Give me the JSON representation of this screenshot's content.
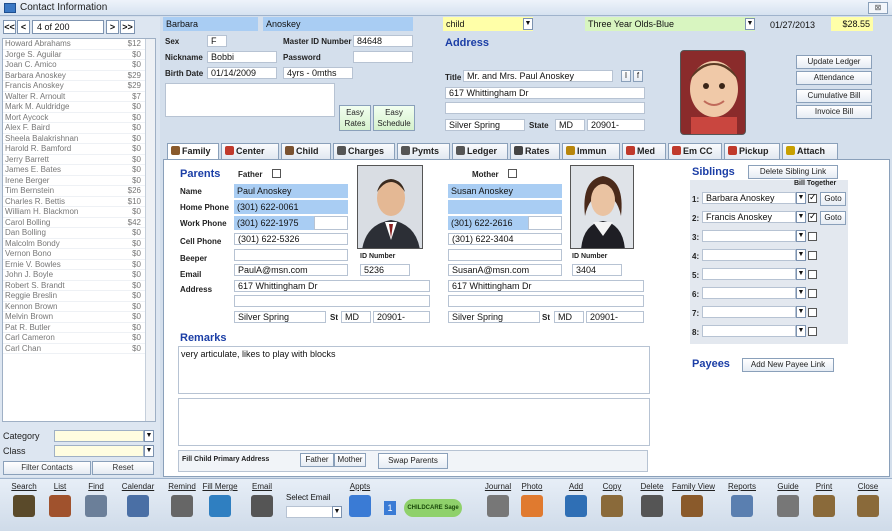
{
  "window": {
    "title": "Contact Information",
    "close": "⊠"
  },
  "nav": {
    "first": "<<",
    "prev": "<",
    "record": "4 of 200",
    "next": ">",
    "last": ">>"
  },
  "list": [
    {
      "name": "Howard Abrahams",
      "amt": "$12"
    },
    {
      "name": "Jorge S. Aguilar",
      "amt": "$0"
    },
    {
      "name": "Joan C. Amico",
      "amt": "$0"
    },
    {
      "name": "Barbara Anoskey",
      "amt": "$29"
    },
    {
      "name": "Francis Anoskey",
      "amt": "$29"
    },
    {
      "name": "Walter R. Arnoult",
      "amt": "$7"
    },
    {
      "name": "Mark M. Auldridge",
      "amt": "$0"
    },
    {
      "name": "Mort Aycock",
      "amt": "$0"
    },
    {
      "name": "Alex F. Baird",
      "amt": "$0"
    },
    {
      "name": "Sheela Balakrishnan",
      "amt": "$0"
    },
    {
      "name": "Harold R. Bamford",
      "amt": "$0"
    },
    {
      "name": "Jerry Barrett",
      "amt": "$0"
    },
    {
      "name": "James E. Bates",
      "amt": "$0"
    },
    {
      "name": "Irene Berger",
      "amt": "$0"
    },
    {
      "name": "Tim Bernstein",
      "amt": "$26"
    },
    {
      "name": "Charles R. Bettis",
      "amt": "$10"
    },
    {
      "name": "William H. Blackmon",
      "amt": "$0"
    },
    {
      "name": "Carol Bolling",
      "amt": "$42"
    },
    {
      "name": "Dan Bolling",
      "amt": "$0"
    },
    {
      "name": "Malcolm Bondy",
      "amt": "$0"
    },
    {
      "name": "Vernon Bono",
      "amt": "$0"
    },
    {
      "name": "Ernie V. Bowles",
      "amt": "$0"
    },
    {
      "name": "John J. Boyle",
      "amt": "$0"
    },
    {
      "name": "Robert S. Brandt",
      "amt": "$0"
    },
    {
      "name": "Reggie Breslin",
      "amt": "$0"
    },
    {
      "name": "Kennon Brown",
      "amt": "$0"
    },
    {
      "name": "Melvin Brown",
      "amt": "$0"
    },
    {
      "name": "Pat R. Butler",
      "amt": "$0"
    },
    {
      "name": "Carl Cameron",
      "amt": "$0"
    },
    {
      "name": "Carl Chan",
      "amt": "$0"
    }
  ],
  "filters": {
    "category_label": "Category",
    "class_label": "Class",
    "filter_btn": "Filter Contacts",
    "reset_btn": "Reset"
  },
  "header": {
    "first_name": "Barbara",
    "last_name": "Anoskey",
    "sex_label": "Sex",
    "sex": "F",
    "master_id_label": "Master ID Number",
    "master_id": "84648",
    "nickname_label": "Nickname",
    "nickname": "Bobbi",
    "password_label": "Password",
    "password": "",
    "birthdate_label": "Birth Date",
    "birthdate": "01/14/2009",
    "age": "4yrs - 0mths",
    "easy_rates": "Easy Rates",
    "easy_schedule": "Easy Schedule",
    "role": "child",
    "class": "Three Year Olds-Blue",
    "date": "01/27/2013",
    "balance": "$28.55",
    "address_title": "Address",
    "title_label": "Title",
    "title_value": "Mr. and Mrs. Paul Anoskey",
    "street": "617 Whittingham Dr",
    "city": "Silver Spring",
    "state_label": "State",
    "state": "MD",
    "zip": "20901-",
    "update_ledger": "Update Ledger",
    "attendance": "Attendance",
    "cumulative_bill": "Cumulative Bill",
    "invoice_bill": "Invoice Bill"
  },
  "tabs": [
    {
      "label": "Family",
      "color": "#8a5a2b"
    },
    {
      "label": "Center",
      "color": "#c0392b"
    },
    {
      "label": "Child",
      "color": "#7a5230"
    },
    {
      "label": "Charges",
      "color": "#555"
    },
    {
      "label": "Pymts",
      "color": "#555"
    },
    {
      "label": "Ledger",
      "color": "#555"
    },
    {
      "label": "Rates",
      "color": "#444"
    },
    {
      "label": "Immun",
      "color": "#b8860b"
    },
    {
      "label": "Med",
      "color": "#c0392b"
    },
    {
      "label": "Em CC",
      "color": "#c0392b"
    },
    {
      "label": "Pickup",
      "color": "#c0392b"
    },
    {
      "label": "Attach",
      "color": "#c8a000"
    }
  ],
  "family": {
    "parents_title": "Parents",
    "father_label": "Father",
    "mother_label": "Mother",
    "name_label": "Name",
    "home_label": "Home Phone",
    "work_label": "Work Phone",
    "cell_label": "Cell Phone",
    "beeper_label": "Beeper",
    "email_label": "Email",
    "address_label": "Address",
    "id_label": "ID Number",
    "father": {
      "name": "Paul Anoskey",
      "home": "(301) 622-0061",
      "work": "(301) 622-1975",
      "cell": "(301) 622-5326",
      "beeper": "",
      "email": "PaulA@msn.com",
      "id": "5236",
      "street": "617 Whittingham Dr",
      "city": "Silver Spring",
      "st_label": "St",
      "st": "MD",
      "zip": "20901-"
    },
    "mother": {
      "name": "Susan Anoskey",
      "home": "",
      "work": "(301) 622-2616",
      "cell": "(301) 622-3404",
      "beeper": "",
      "email": "SusanA@msn.com",
      "id": "3404",
      "street": "617 Whittingham Dr",
      "city": "Silver Spring",
      "st_label": "St",
      "st": "MD",
      "zip": "20901-"
    },
    "remarks_title": "Remarks",
    "remarks": "very articulate, likes to play with blocks",
    "fill_label": "Fill Child Primary Address",
    "father_btn": "Father",
    "mother_btn": "Mother",
    "swap_btn": "Swap Parents"
  },
  "siblings": {
    "title": "Siblings",
    "delete_btn": "Delete Sibling Link",
    "bill_together": "Bill Together",
    "goto": "Goto",
    "rows": [
      {
        "n": "1:",
        "name": "Barbara Anoskey",
        "checked": true
      },
      {
        "n": "2:",
        "name": "Francis Anoskey",
        "checked": true
      },
      {
        "n": "3:",
        "name": "",
        "checked": false
      },
      {
        "n": "4:",
        "name": "",
        "checked": false
      },
      {
        "n": "5:",
        "name": "",
        "checked": false
      },
      {
        "n": "6:",
        "name": "",
        "checked": false
      },
      {
        "n": "7:",
        "name": "",
        "checked": false
      },
      {
        "n": "8:",
        "name": "",
        "checked": false
      }
    ]
  },
  "payees": {
    "title": "Payees",
    "add_btn": "Add New Payee Link"
  },
  "toolbar": [
    {
      "label": "Search",
      "icon": "binoculars-icon",
      "color": "#5a4a2a"
    },
    {
      "label": "List",
      "icon": "books-icon",
      "color": "#a0522d"
    },
    {
      "label": "Find",
      "icon": "magnifier-icon",
      "color": "#6b7f99"
    },
    {
      "label": "Calendar",
      "icon": "calendar-icon",
      "color": "#4a6fa5"
    },
    {
      "label": "Remind",
      "icon": "gear-icon",
      "color": "#666"
    },
    {
      "label": "Fill Merge",
      "icon": "merge-icon",
      "color": "#2f7fc1"
    },
    {
      "label": "Email",
      "icon": "email-icon",
      "color": "#555"
    },
    {
      "label": "Select Email",
      "icon": "",
      "color": ""
    },
    {
      "label": "Appts",
      "icon": "appts-icon",
      "color": "#3a7bd5"
    },
    {
      "label": "Journal",
      "icon": "journal-icon",
      "color": "#777"
    },
    {
      "label": "Photo",
      "icon": "photo-icon",
      "color": "#e07a2f"
    },
    {
      "label": "Add",
      "icon": "add-icon",
      "color": "#2f6fb5"
    },
    {
      "label": "Copy",
      "icon": "copy-icon",
      "color": "#8a6a3a"
    },
    {
      "label": "Delete",
      "icon": "trash-icon",
      "color": "#555"
    },
    {
      "label": "Family View",
      "icon": "family-icon",
      "color": "#8a5a2b"
    },
    {
      "label": "Reports",
      "icon": "reports-icon",
      "color": "#5a7fb0"
    },
    {
      "label": "Guide",
      "icon": "bulb-icon",
      "color": "#777"
    },
    {
      "label": "Print",
      "icon": "print-icon",
      "color": "#8a6a3a"
    },
    {
      "label": "Close",
      "icon": "door-icon",
      "color": "#8a6a3a"
    }
  ],
  "appts_count": "1",
  "childcare_badge": "CHILDCARE Sage"
}
